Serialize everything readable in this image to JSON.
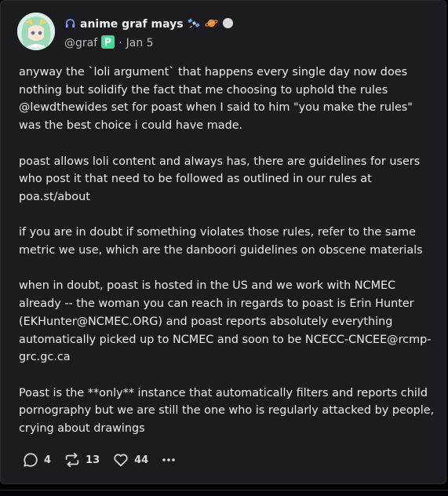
{
  "author": {
    "display_name": "anime graf mays",
    "handle": "@graf",
    "separator": "·",
    "date": "Jan 5",
    "badge_letter": "P"
  },
  "post": {
    "paragraphs": [
      "anyway the `loli argument` that happens every single day now does nothing but solidify the fact that me choosing to uphold the rules @lewdthewides set for poast when I said to him \"you make the rules\" was the best choice i could have made.",
      "poast allows loli content and always has, there are guidelines for users who post it that need to be followed as outlined in our rules at poa.st/about",
      "if you are in doubt if something violates those rules, refer to the same metric we use, which are the danboori guidelines on obscene materials",
      "when in doubt, poast is hosted in the US and we work with NCMEC already -- the woman you can reach in regards to poast is Erin Hunter (EKHunter@NCMEC.ORG) and poast reports absolutely everything automatically picked up to NCMEC and soon to be NCECC-CNCEE@rcmp-grc.gc.ca",
      "Poast is the **only** instance that automatically filters and reports child pornography but we are still the one who is regularly attacked by people, crying about drawings"
    ]
  },
  "actions": {
    "replies": "4",
    "reposts": "13",
    "likes": "44"
  },
  "colors": {
    "background": "#000000",
    "card": "#1c1c20",
    "text": "#ececee",
    "muted": "#b9b9c0",
    "badge": "#3ddc97"
  }
}
